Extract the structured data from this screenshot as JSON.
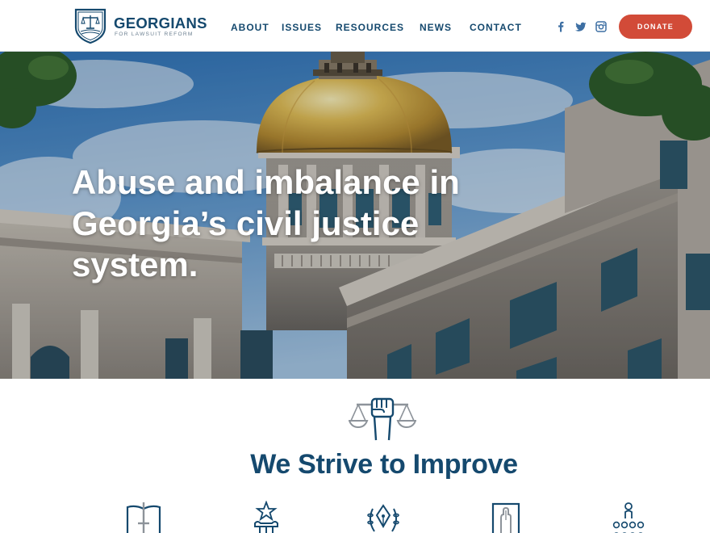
{
  "header": {
    "logo": {
      "name": "GEORGIANS",
      "tagline": "FOR LAWSUIT REFORM",
      "icon": "scales-shield-icon"
    },
    "nav": [
      {
        "label": "ABOUT"
      },
      {
        "label": "ISSUES"
      },
      {
        "label": "RESOURCES"
      },
      {
        "label": "NEWS"
      },
      {
        "label": "CONTACT"
      }
    ],
    "social": [
      "facebook-icon",
      "twitter-icon",
      "instagram-icon"
    ],
    "donate_label": "DONATE"
  },
  "hero": {
    "heading": "Abuse and imbalance in Georgia’s civil justice system.",
    "image": "georgia-state-capitol-gold-dome"
  },
  "section": {
    "icon": "scales-fist-icon",
    "title": "We Strive to Improve",
    "feature_icons": [
      "book-sword-icon",
      "star-column-icon",
      "pen-laurel-icon",
      "hand-on-book-icon",
      "people-group-icon"
    ]
  },
  "colors": {
    "navy": "#15496e",
    "donate_red": "#d24b38",
    "icon_gray": "#8d939a",
    "text_white": "#ffffff"
  }
}
